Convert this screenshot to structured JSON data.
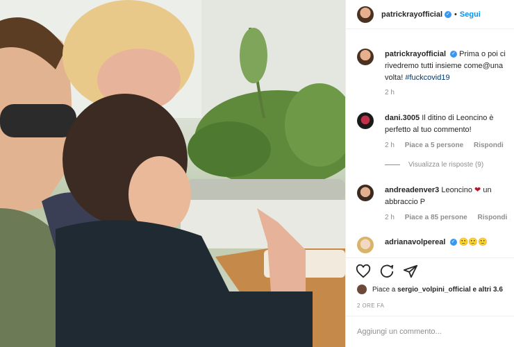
{
  "header": {
    "username": "patrickrayofficial",
    "separator": "•",
    "follow_label": "Segui"
  },
  "caption": {
    "username": "patrickrayofficial",
    "text": "Prima o poi ci rivedremo tutti insieme come@una volta!",
    "hashtag": "#fuckcovid19",
    "time": "2 h"
  },
  "comments": [
    {
      "username": "dani.3005",
      "text": "Il ditino di Leoncino è perfetto al tuo commento!",
      "time": "2 h",
      "likes": "Piace a 5 persone",
      "reply": "Rispondi"
    },
    {
      "username": "andreadenver3",
      "text_before": "Leoncino",
      "text_after": "un abbraccio P",
      "time": "2 h",
      "likes": "Piace a 85 persone",
      "reply": "Rispondi"
    },
    {
      "username": "adrianavolpereal",
      "text": "🙂🙂🙂"
    }
  ],
  "view_replies": "Visualizza le risposte (9)",
  "liked_by": {
    "prefix": "Piace a",
    "user": "sergio_volpini_official",
    "suffix": "e altri 3.6"
  },
  "time_ago": "2 ORE FA",
  "add_comment": {
    "placeholder": "Aggiungi un commento..."
  },
  "icons": [
    "heart-icon",
    "comment-icon",
    "share-icon",
    "verified-icon"
  ],
  "colors": {
    "link": "#0095f6",
    "verified": "#3897f0",
    "heart": "#b3162c"
  }
}
